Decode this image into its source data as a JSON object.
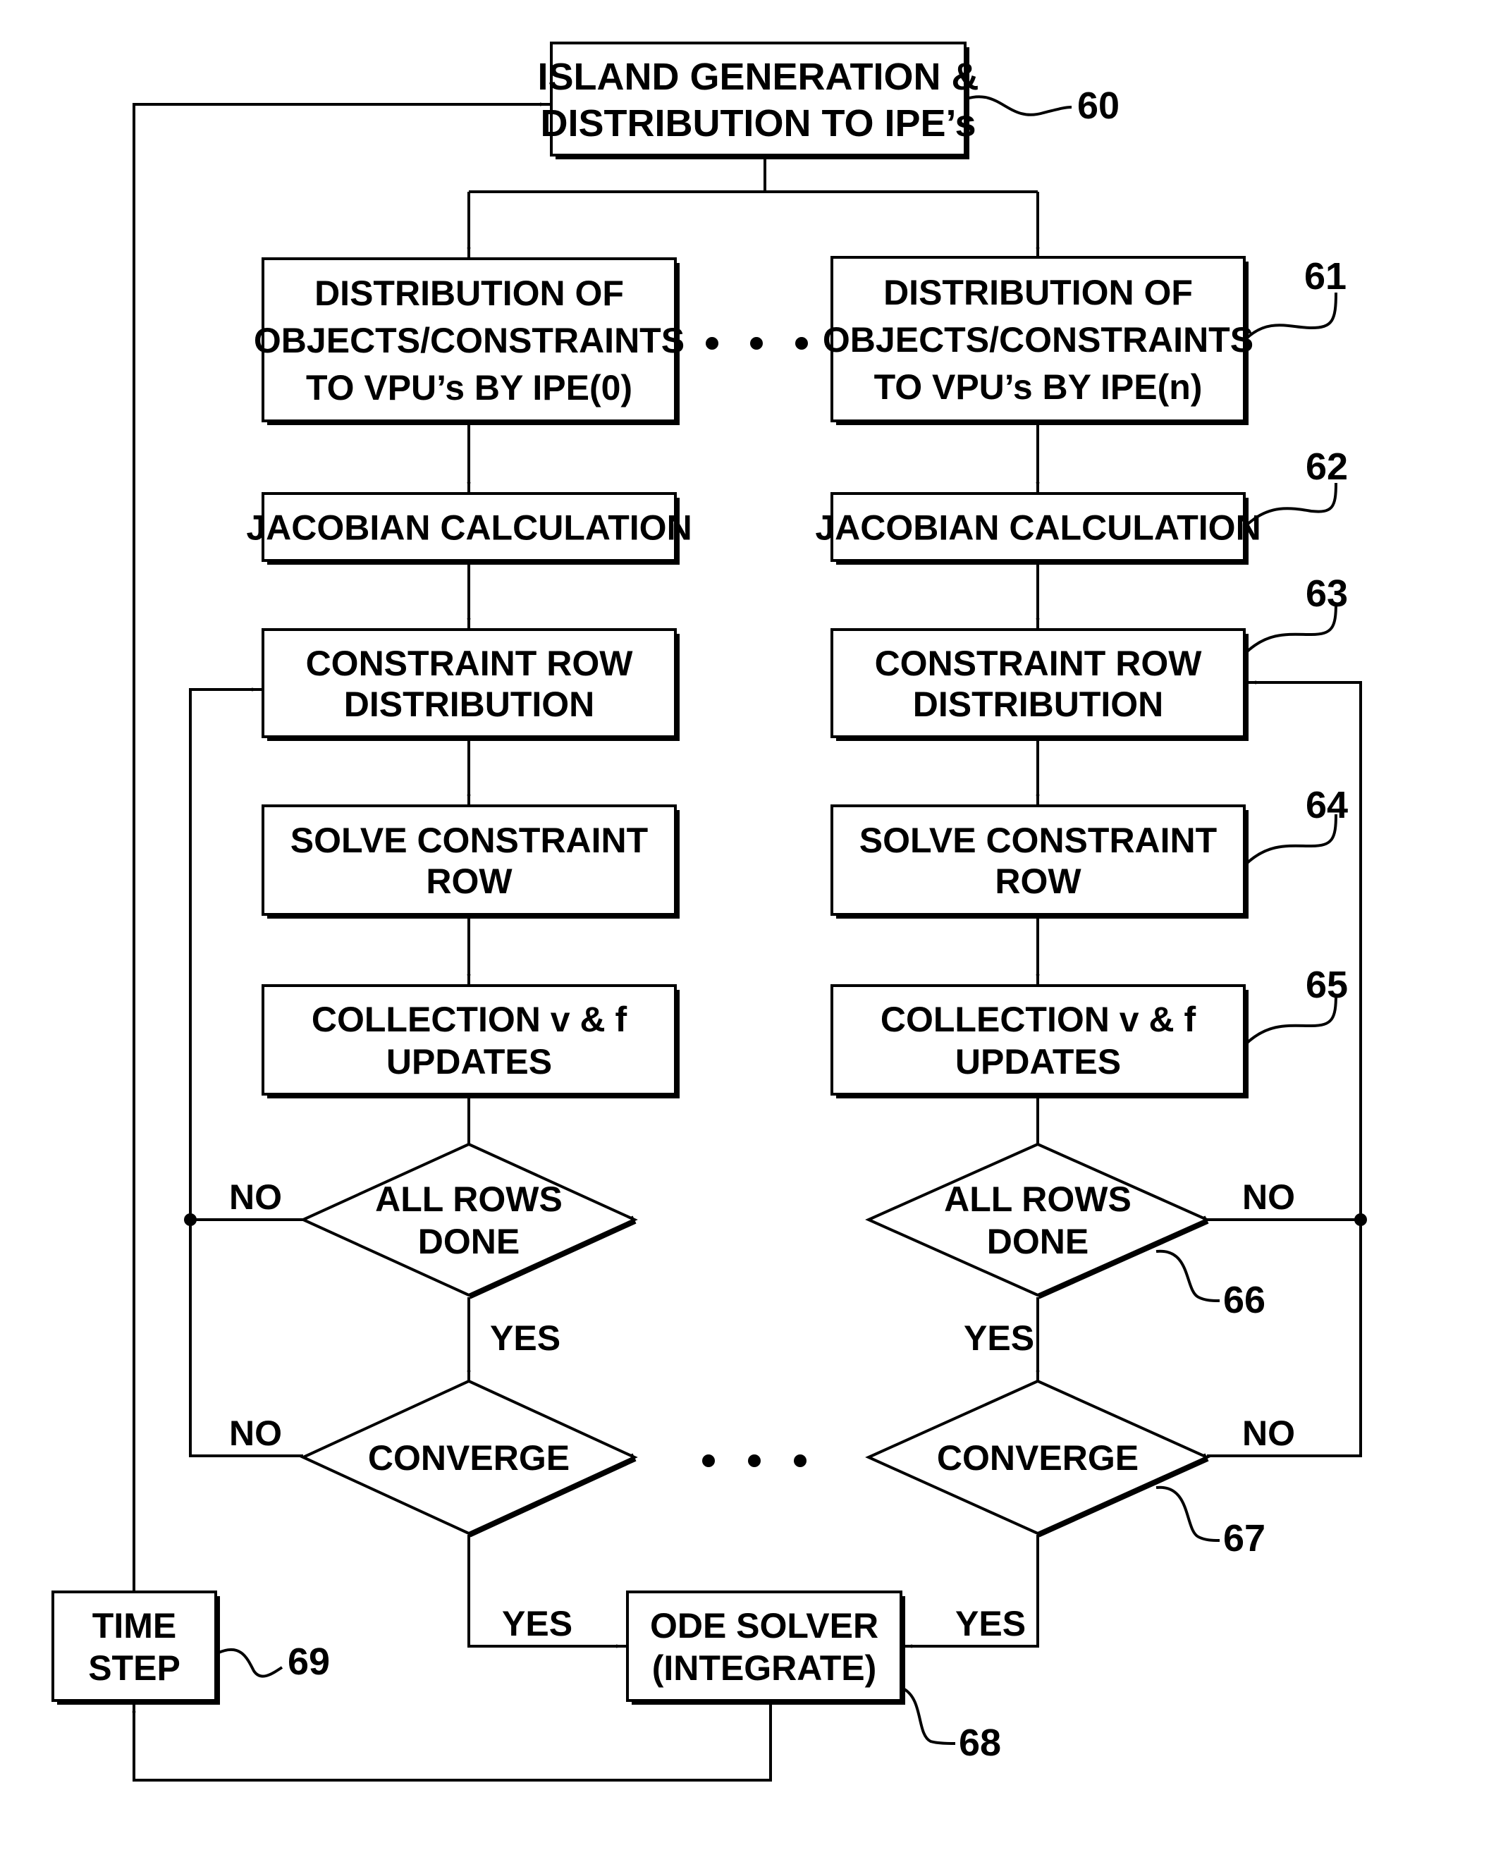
{
  "figure": {
    "nodes": {
      "island": {
        "lines": [
          "ISLAND  GENERATION  &",
          "DISTRIBUTION  TO  IPE’s"
        ],
        "ref": "60"
      },
      "dist_left": {
        "lines": [
          "DISTRIBUTION  OF",
          "OBJECTS/CONSTRAINTS",
          "TO  VPU’s  BY  IPE(0)"
        ]
      },
      "dist_right": {
        "lines": [
          "DISTRIBUTION  OF",
          "OBJECTS/CONSTRAINTS",
          "TO  VPU’s  BY  IPE(n)"
        ],
        "ref": "61"
      },
      "jac_left": {
        "lines": [
          "JACOBIAN  CALCULATION"
        ]
      },
      "jac_right": {
        "lines": [
          "JACOBIAN  CALCULATION"
        ],
        "ref": "62"
      },
      "crd_left": {
        "lines": [
          "CONSTRAINT  ROW",
          "DISTRIBUTION"
        ]
      },
      "crd_right": {
        "lines": [
          "CONSTRAINT  ROW",
          "DISTRIBUTION"
        ],
        "ref": "63"
      },
      "solve_left": {
        "lines": [
          "SOLVE  CONSTRAINT",
          "ROW"
        ]
      },
      "solve_right": {
        "lines": [
          "SOLVE  CONSTRAINT",
          "ROW"
        ],
        "ref": "64"
      },
      "coll_left": {
        "lines": [
          "COLLECTION  v  &  f",
          "UPDATES"
        ]
      },
      "coll_right": {
        "lines": [
          "COLLECTION  v  &  f",
          "UPDATES"
        ],
        "ref": "65"
      },
      "rows_left": {
        "lines": [
          "ALL  ROWS",
          "DONE"
        ]
      },
      "rows_right": {
        "lines": [
          "ALL  ROWS",
          "DONE"
        ],
        "ref": "66"
      },
      "conv_left": {
        "lines": [
          "CONVERGE"
        ]
      },
      "conv_right": {
        "lines": [
          "CONVERGE"
        ],
        "ref": "67"
      },
      "ode": {
        "lines": [
          "ODE  SOLVER",
          "(INTEGRATE)"
        ],
        "ref": "68"
      },
      "timestep": {
        "lines": [
          "TIME",
          "STEP"
        ],
        "ref": "69"
      }
    },
    "edge_labels": {
      "no": "NO",
      "yes": "YES"
    },
    "ellipsis": "• • •"
  }
}
